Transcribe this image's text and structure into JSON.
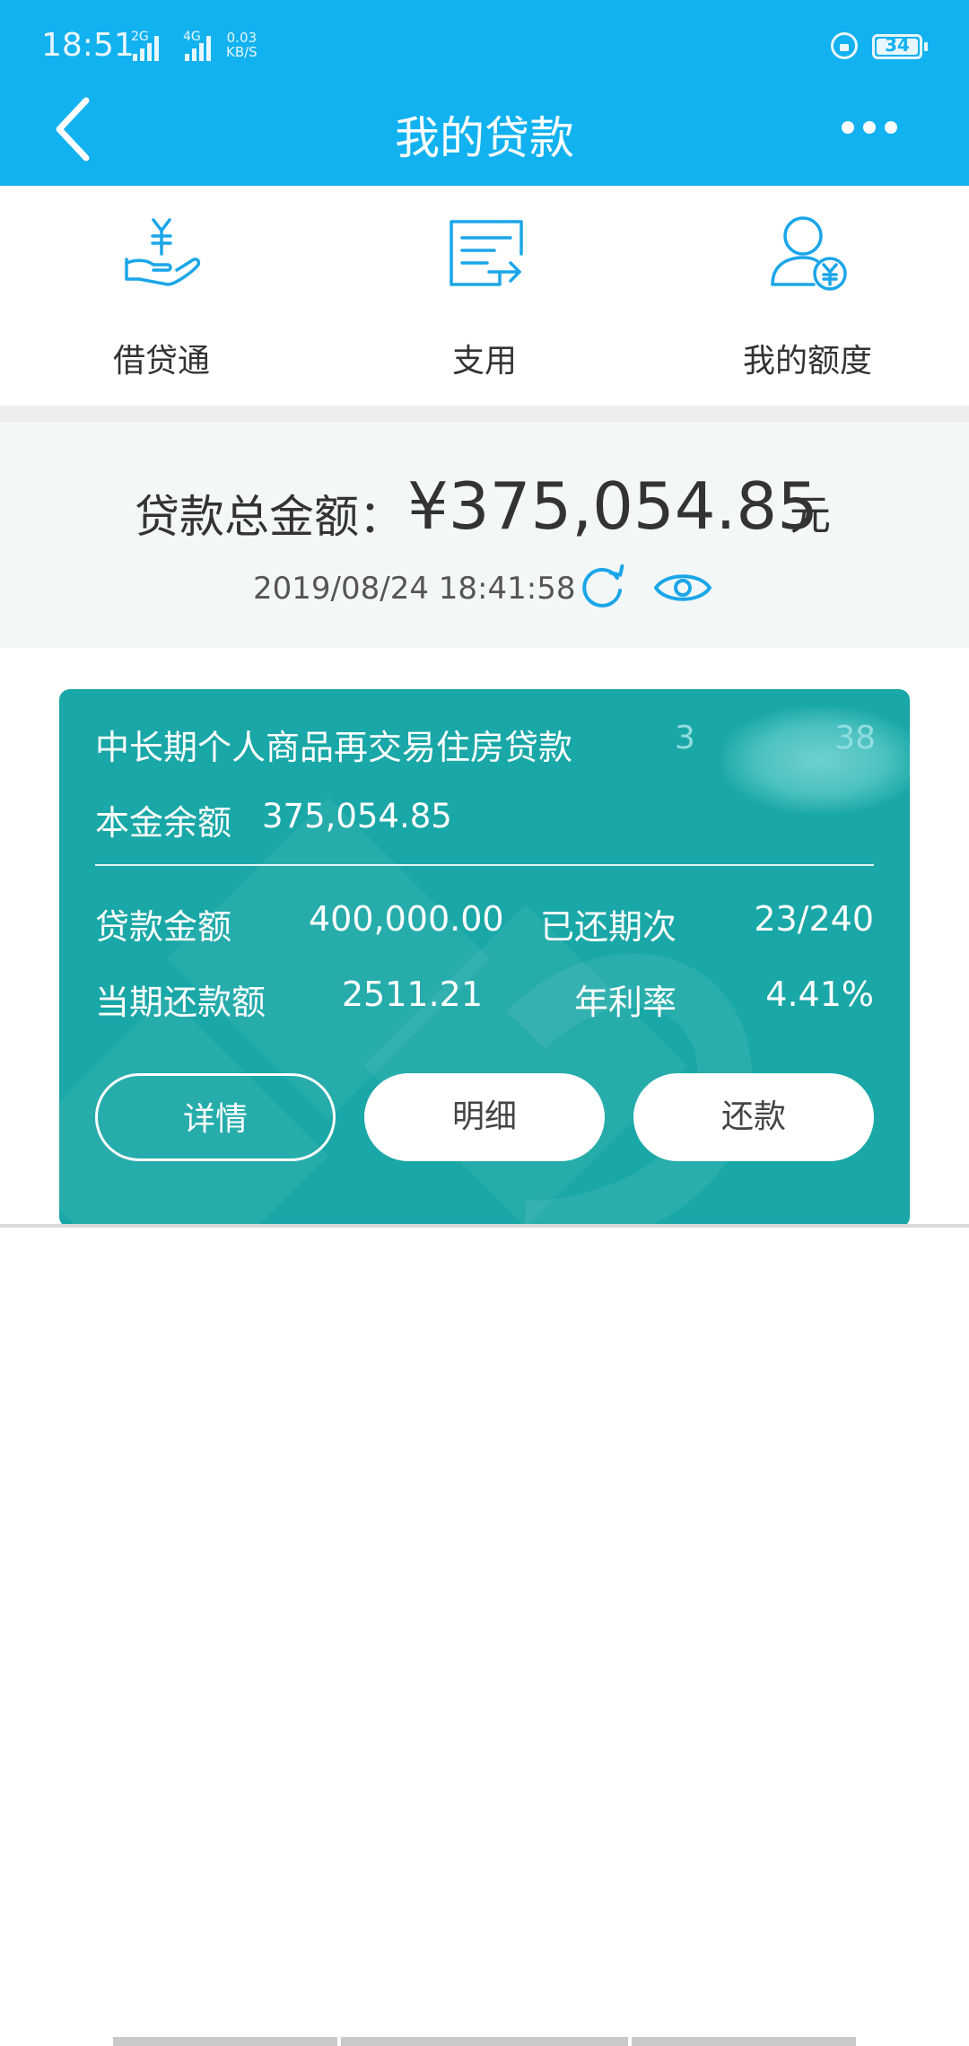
{
  "status_bar": {
    "time": "18:51",
    "net1": "2G",
    "net2": "4G",
    "speed_value": "0.03",
    "speed_unit": "KB/S",
    "battery": "34"
  },
  "header": {
    "title": "我的贷款",
    "back_icon": "chevron-left-icon",
    "more_icon": "more-icon"
  },
  "quick_actions": [
    {
      "label": "借贷通",
      "icon": "hand-yuan-icon"
    },
    {
      "label": "支用",
      "icon": "document-arrow-icon"
    },
    {
      "label": "我的额度",
      "icon": "user-yuan-icon"
    }
  ],
  "summary": {
    "label": "贷款总金额：",
    "amount": "¥375,054.85",
    "unit": "元",
    "timestamp": "2019/08/24 18:41:58"
  },
  "loan_card": {
    "product_name": "中长期个人商品再交易住房贷款",
    "account_prefix": "3",
    "account_suffix": "38",
    "principal_label": "本金余额",
    "principal_value": "375,054.85",
    "loan_amount_label": "贷款金额",
    "loan_amount_value": "400,000.00",
    "repaid_periods_label": "已还期次",
    "repaid_periods_value": "23/240",
    "current_payment_label": "当期还款额",
    "current_payment_value": "2511.21",
    "annual_rate_label": "年利率",
    "annual_rate_value": "4.41%",
    "buttons": {
      "details": "详情",
      "statement": "明细",
      "repay": "还款"
    }
  },
  "colors": {
    "header": "#12b2f0",
    "card": "#1aa7a7",
    "icon": "#1ba6e8"
  }
}
